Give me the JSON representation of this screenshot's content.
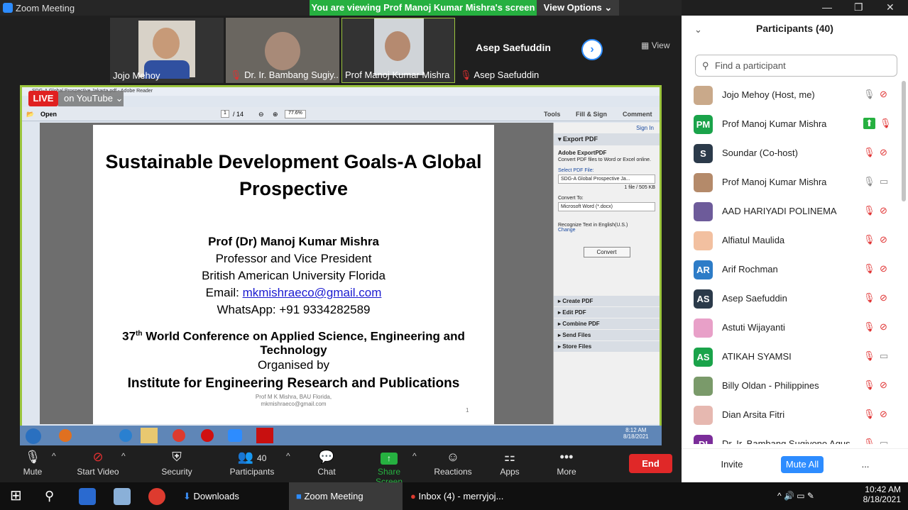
{
  "window": {
    "title": "Zoom Meeting"
  },
  "banner": {
    "text": "You are viewing Prof Manoj Kumar Mishra's screen",
    "view_options": "View Options"
  },
  "video_strip": {
    "tiles": [
      {
        "name": "Jojo Mehoy"
      },
      {
        "name": "Dr. Ir. Bambang Sugiy..."
      },
      {
        "name": "Prof Manoj Kumar Mishra"
      },
      {
        "name": "Asep Saefuddin"
      }
    ],
    "big_name": "Asep Saefuddin",
    "view_label": "View"
  },
  "live": {
    "badge": "LIVE",
    "on_text": "on YouTube"
  },
  "reader": {
    "title": "SDG-A Global Prospective Jakarta.pdf - Adobe Reader",
    "open": "Open",
    "page_num": "1",
    "page_total": "/ 14",
    "zoom": "77.6%",
    "tools": "Tools",
    "fill_sign": "Fill & Sign",
    "comment": "Comment",
    "sign_in": "Sign In",
    "export_pdf": "Export PDF",
    "adobe_export": "Adobe ExportPDF",
    "export_desc": "Convert PDF files to Word or Excel online.",
    "select_file": "Select PDF File:",
    "file_name": "SDG-A Global Prospective Ja...",
    "file_size": "1 file / 505 KB",
    "convert_to": "Convert To:",
    "format": "Microsoft Word (*.docx)",
    "recognize": "Recognize Text in English(U.S.)",
    "change": "Change",
    "convert_btn": "Convert",
    "sections": [
      "Create PDF",
      "Edit PDF",
      "Combine PDF",
      "Send Files",
      "Store Files"
    ],
    "clock_time": "8:12 AM",
    "clock_date": "8/18/2021"
  },
  "pdf": {
    "title1": "Sustainable Development Goals-A Global",
    "title2": "Prospective",
    "author": "Prof (Dr) Manoj Kumar Mishra",
    "role": "Professor and Vice President",
    "univ": "British American University Florida",
    "email_label": "Email: ",
    "email": "mkmishraeco@gmail.com",
    "whatsapp": "WhatsApp: +91 9334282589",
    "conf_num": "37",
    "conf_sup": "th",
    "conf_rest": " World Conference on Applied Science, Engineering and",
    "conf_line2": "Technology",
    "organised": "Organised by",
    "institute": "Institute for Engineering Research and Publications",
    "footer1": "Prof M K Mishra, BAU Florida,",
    "footer2": "mkmishraeco@gmail.com",
    "page_no": "1"
  },
  "toolbar": {
    "mute": "Mute",
    "start_video": "Start Video",
    "security": "Security",
    "participants": "Participants",
    "participants_count": "40",
    "chat": "Chat",
    "share_screen": "Share Screen",
    "reactions": "Reactions",
    "apps": "Apps",
    "more": "More",
    "end": "End"
  },
  "panel": {
    "title": "Participants (40)",
    "search_placeholder": "Find a participant",
    "participants": [
      {
        "name": "Jojo Mehoy (Host, me)",
        "initials": "",
        "color": "#c9a98a",
        "mic": "on",
        "cam": "off"
      },
      {
        "name": "Prof Manoj Kumar Mishra",
        "initials": "PM",
        "color": "#1aa34a",
        "mic": "share",
        "cam": "off-mic"
      },
      {
        "name": "Soundar (Co-host)",
        "initials": "S",
        "color": "#2b3a4a",
        "mic": "off",
        "cam": "off"
      },
      {
        "name": "Prof Manoj Kumar Mishra",
        "initials": "",
        "color": "#b48a6a",
        "mic": "on",
        "cam": "on"
      },
      {
        "name": "AAD HARIYADI POLINEMA",
        "initials": "",
        "color": "#6d5b9a",
        "mic": "off",
        "cam": "off"
      },
      {
        "name": "Alfiatul Maulida",
        "initials": "",
        "color": "#f2c0a0",
        "mic": "off",
        "cam": "off"
      },
      {
        "name": "Arif Rochman",
        "initials": "AR",
        "color": "#2d7cc7",
        "mic": "off",
        "cam": "off"
      },
      {
        "name": "Asep Saefuddin",
        "initials": "AS",
        "color": "#2b3a4a",
        "mic": "off",
        "cam": "off"
      },
      {
        "name": "Astuti Wijayanti",
        "initials": "",
        "color": "#e8a0c8",
        "mic": "off",
        "cam": "off"
      },
      {
        "name": "ATIKAH SYAMSI",
        "initials": "AS",
        "color": "#1aa34a",
        "mic": "off",
        "cam": "on"
      },
      {
        "name": "Billy Oldan - Philippines",
        "initials": "",
        "color": "#7a9a6a",
        "mic": "off",
        "cam": "off"
      },
      {
        "name": "Dian Arsita Fitri",
        "initials": "",
        "color": "#e6b8b0",
        "mic": "off",
        "cam": "off"
      },
      {
        "name": "Dr. Ir. Bambang Sugiyono Agus",
        "initials": "DI",
        "color": "#7b2d9a",
        "mic": "off",
        "cam": "on"
      }
    ],
    "invite": "Invite",
    "mute_all": "Mute All",
    "more": "..."
  },
  "taskbar": {
    "downloads": "Downloads",
    "zoom": "Zoom Meeting",
    "chrome": "Inbox (4) - merryjoj...",
    "time": "10:42 AM",
    "date": "8/18/2021"
  },
  "colors": {
    "accent": "#2d8cff",
    "green": "#26b040",
    "red": "#e02828",
    "share_border": "#9bc53d"
  }
}
